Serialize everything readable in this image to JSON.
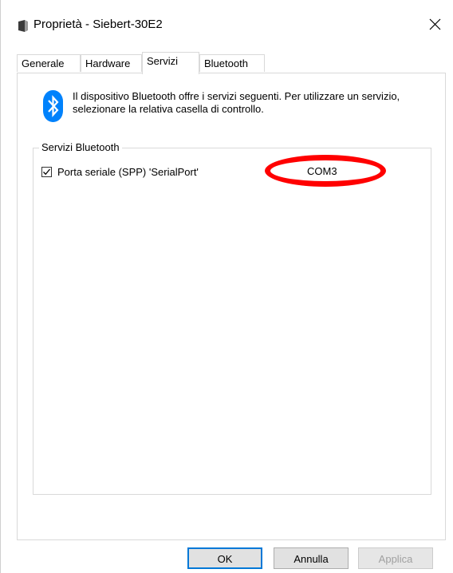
{
  "window": {
    "title": "Proprietà - Siebert-30E2"
  },
  "tabs": [
    {
      "label": "Generale"
    },
    {
      "label": "Hardware"
    },
    {
      "label": "Servizi"
    },
    {
      "label": "Bluetooth"
    }
  ],
  "active_tab": "Servizi",
  "info": {
    "text": "Il dispositivo Bluetooth offre i servizi seguenti. Per utilizzare un servizio, selezionare la relativa casella di controllo."
  },
  "group": {
    "label": "Servizi Bluetooth"
  },
  "services": [
    {
      "label": "Porta seriale (SPP) 'SerialPort'",
      "checked": true,
      "port": "COM3"
    }
  ],
  "buttons": {
    "ok": "OK",
    "cancel": "Annulla",
    "apply": "Applica"
  },
  "colors": {
    "bluetooth_blue": "#0082fc",
    "annotation_red": "#ff0000",
    "focus_blue": "#0078d7"
  },
  "icons": {
    "title": "device-icon",
    "close": "close-icon",
    "bluetooth": "bluetooth-icon",
    "checkbox": "checkmark-icon"
  }
}
